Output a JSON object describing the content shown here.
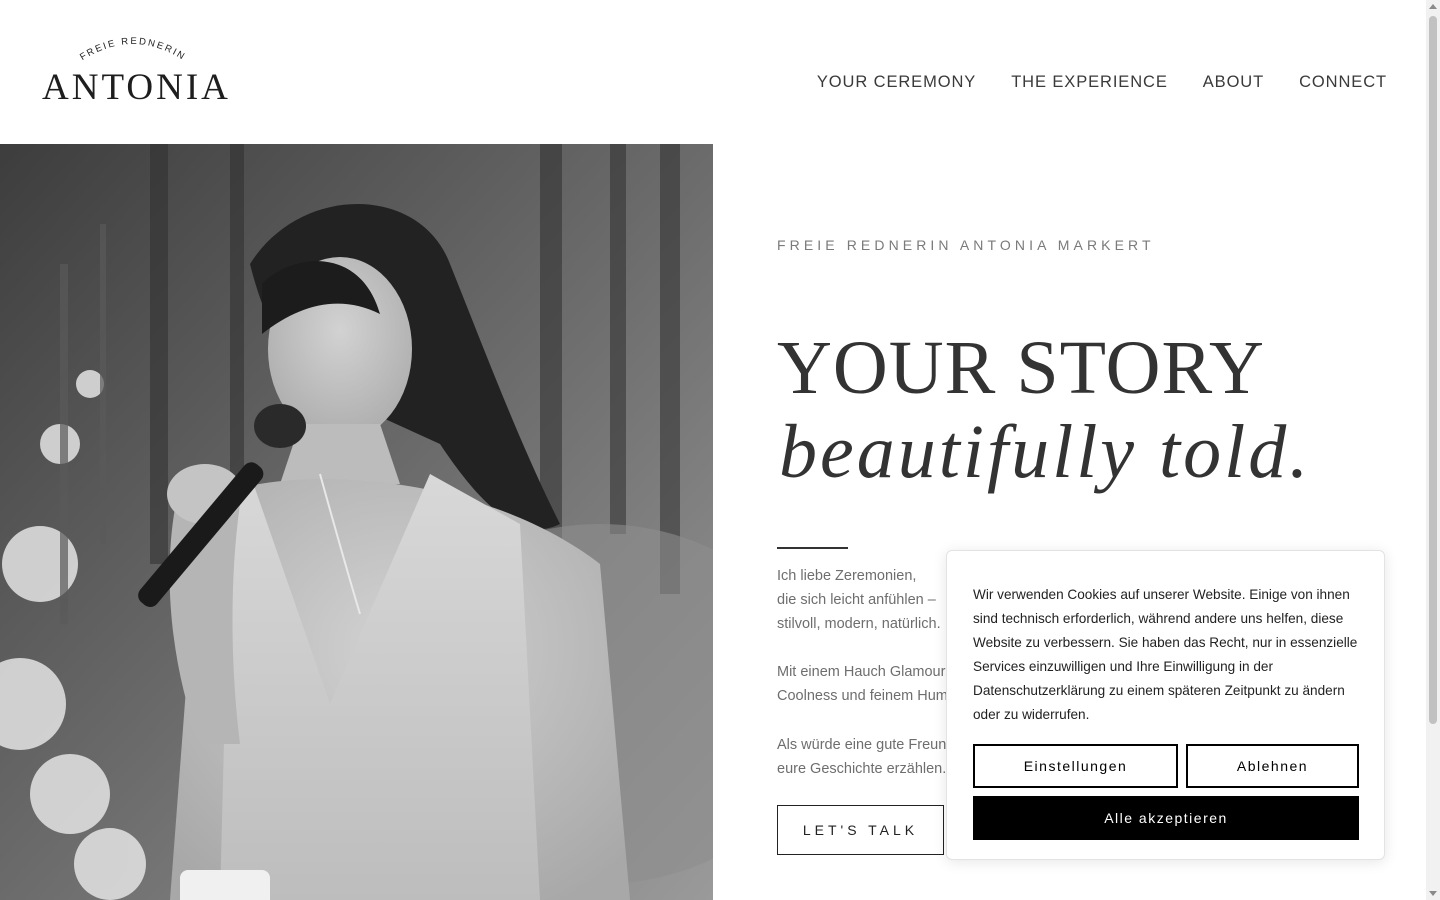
{
  "header": {
    "logo_arc_text": "FREIE REDNERIN",
    "logo_word": "ANTONIA",
    "nav": [
      {
        "label": "YOUR CEREMONY"
      },
      {
        "label": "THE EXPERIENCE"
      },
      {
        "label": "ABOUT"
      },
      {
        "label": "CONNECT"
      }
    ]
  },
  "hero": {
    "eyebrow": "FREIE REDNERIN ANTONIA MARKERT",
    "headline": "YOUR STORY",
    "headline_italic": "beautifully told.",
    "paragraphs": [
      {
        "lines": [
          "Ich liebe Zeremonien,",
          "die sich leicht anfühlen –",
          "stilvoll, modern, natürlich."
        ]
      },
      {
        "lines": [
          "Mit einem Hauch Glamour,",
          "Coolness und feinem Hum"
        ]
      },
      {
        "lines": [
          "Als würde eine gute Freun",
          "eure Geschichte erzählen."
        ]
      }
    ],
    "cta_label": "LET'S TALK"
  },
  "cookie_banner": {
    "text": "Wir verwenden Cookies auf unserer Website. Einige von ihnen sind technisch erforderlich, während andere uns helfen, diese Website zu verbessern. Sie haben das Recht, nur in essenzielle Services einzuwilligen und Ihre Einwilligung in der Datenschutzerklärung zu einem späteren Zeitpunkt zu ändern oder zu widerrufen.",
    "settings_label": "Einstellungen",
    "decline_label": "Ablehnen",
    "accept_label": "Alle akzeptieren"
  },
  "colors": {
    "accent": "#000000",
    "text": "#333333",
    "muted": "#7a7a7a"
  }
}
